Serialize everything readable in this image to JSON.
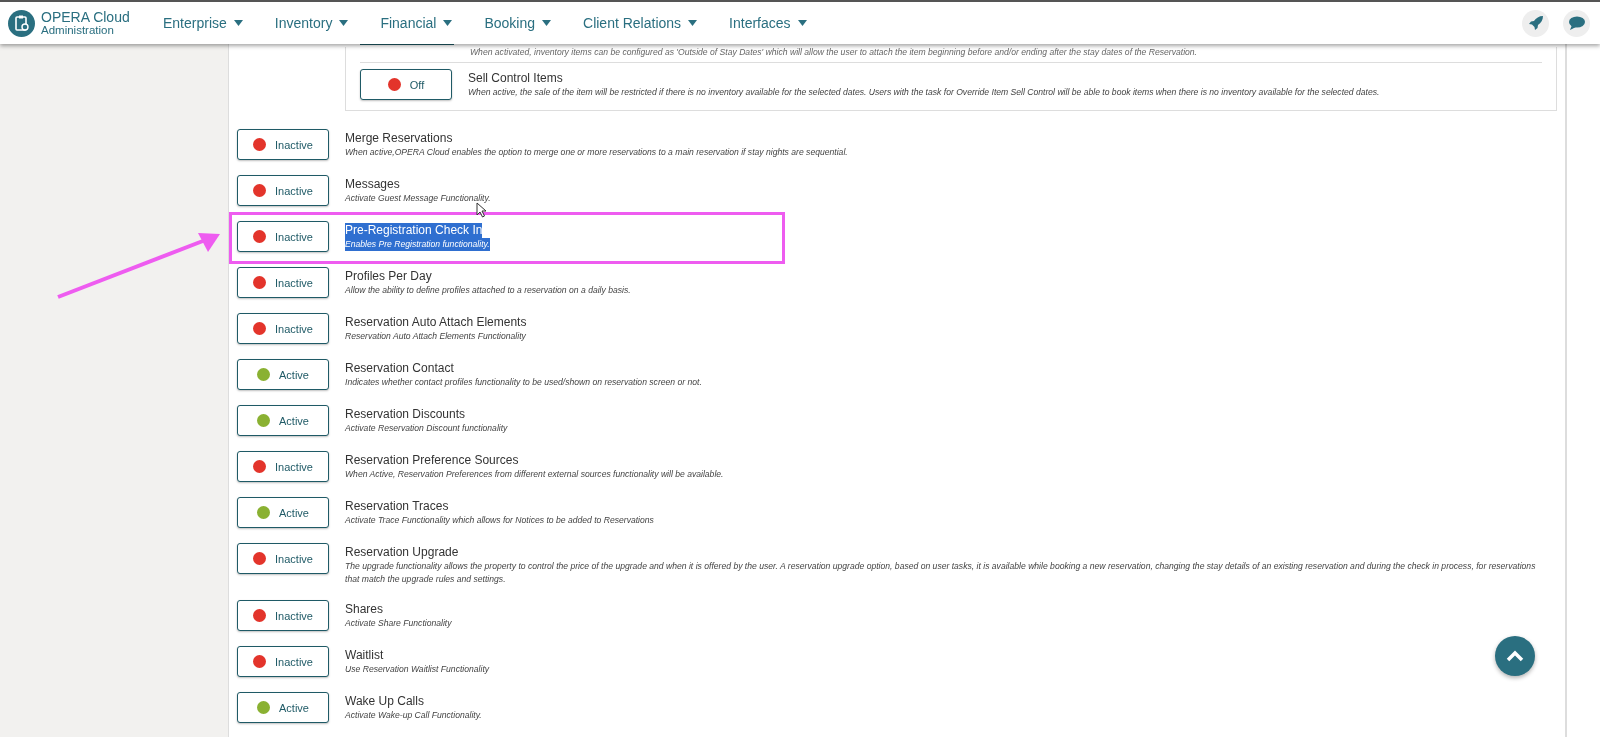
{
  "app": {
    "title": "OPERA Cloud",
    "subtitle": "Administration"
  },
  "menu": [
    {
      "label": "Enterprise"
    },
    {
      "label": "Inventory"
    },
    {
      "label": "Financial"
    },
    {
      "label": "Booking"
    },
    {
      "label": "Client Relations"
    },
    {
      "label": "Interfaces"
    }
  ],
  "sub_panel": {
    "items": [
      {
        "kind": "cut",
        "description": "When activated, inventory items can be configured as 'Outside of Stay Dates' which will allow the user to attach the item beginning before and/or ending after the stay dates of the Reservation."
      },
      {
        "kind": "toggle",
        "title": "Sell Control Items",
        "status": "Off",
        "on": false,
        "description": "When active, the sale of the item will be restricted if there is no inventory available for the selected dates. Users with the task for Override Item Sell Control will be able to book items when there is no inventory available for the selected dates."
      }
    ]
  },
  "functions": [
    {
      "title": "Merge Reservations",
      "status": "Inactive",
      "active": false,
      "selected": false,
      "description": "When active,OPERA Cloud enables the option to merge one or more reservations to a main reservation if stay nights are sequential."
    },
    {
      "title": "Messages",
      "status": "Inactive",
      "active": false,
      "selected": false,
      "description": "Activate Guest Message Functionality."
    },
    {
      "title": "Pre-Registration Check In",
      "status": "Inactive",
      "active": false,
      "selected": true,
      "description": "Enables Pre Registration functionality."
    },
    {
      "title": "Profiles Per Day",
      "status": "Inactive",
      "active": false,
      "selected": false,
      "description": "Allow the ability to define profiles attached to a reservation on a daily basis."
    },
    {
      "title": "Reservation Auto Attach Elements",
      "status": "Inactive",
      "active": false,
      "selected": false,
      "description": "Reservation Auto Attach Elements Functionality"
    },
    {
      "title": "Reservation Contact",
      "status": "Active",
      "active": true,
      "selected": false,
      "description": "Indicates whether contact profiles functionality to be used/shown on reservation screen or not."
    },
    {
      "title": "Reservation Discounts",
      "status": "Active",
      "active": true,
      "selected": false,
      "description": "Activate Reservation Discount functionality"
    },
    {
      "title": "Reservation Preference Sources",
      "status": "Inactive",
      "active": false,
      "selected": false,
      "description": "When Active, Reservation Preferences from different external sources functionality will be available."
    },
    {
      "title": "Reservation Traces",
      "status": "Active",
      "active": true,
      "selected": false,
      "description": "Activate Trace Functionality which allows for Notices to be added to Reservations"
    },
    {
      "title": "Reservation Upgrade",
      "status": "Inactive",
      "active": false,
      "selected": false,
      "description": "The upgrade functionality allows the property to control the price of the upgrade and when it is offered by the user. A reservation upgrade option, based on user tasks, it is available while booking a new reservation, changing the stay details of an existing reservation and during the check in process, for reservations that match the upgrade rules and settings."
    },
    {
      "title": "Shares",
      "status": "Inactive",
      "active": false,
      "selected": false,
      "description": "Activate Share Functionality"
    },
    {
      "title": "Waitlist",
      "status": "Inactive",
      "active": false,
      "selected": false,
      "description": "Use Reservation Waitlist Functionality"
    },
    {
      "title": "Wake Up Calls",
      "status": "Active",
      "active": true,
      "selected": false,
      "description": "Activate Wake-up Call Functionality."
    }
  ]
}
